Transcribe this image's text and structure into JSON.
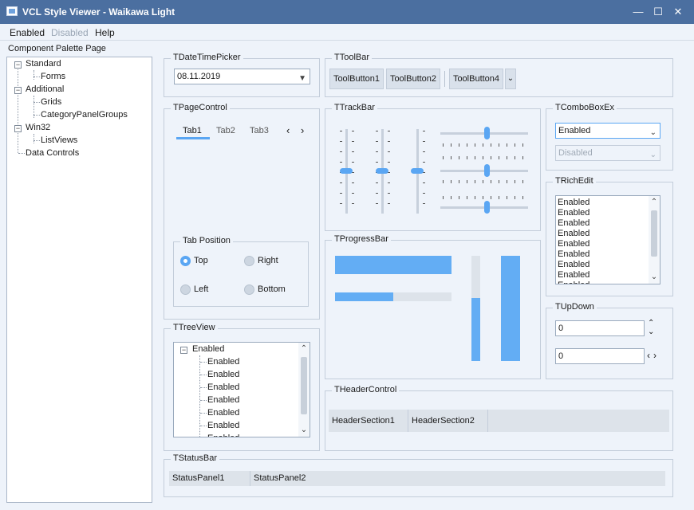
{
  "window": {
    "title": "VCL Style Viewer - Waikawa Light",
    "minimize_glyph": "—",
    "maximize_glyph": "☐",
    "close_glyph": "✕"
  },
  "menu": [
    "Enabled",
    "Disabled",
    "Help"
  ],
  "palette": {
    "label": "Component Palette Page",
    "tree": [
      "Standard",
      "Forms",
      "Additional",
      "Grids",
      "CategoryPanelGroups",
      "Win32",
      "ListViews",
      "Data Controls"
    ]
  },
  "datetimepicker": {
    "title": "TDateTimePicker",
    "value": "08.11.2019"
  },
  "toolbar": {
    "title": "TToolBar",
    "buttons": [
      "ToolButton1",
      "ToolButton2",
      "ToolButton4"
    ]
  },
  "pagecontrol": {
    "title": "TPageControl",
    "tabs": [
      "Tab1",
      "Tab2",
      "Tab3"
    ],
    "tab_position": {
      "title": "Tab Position",
      "options": [
        "Top",
        "Right",
        "Left",
        "Bottom"
      ],
      "selected": "Top"
    }
  },
  "trackbar": {
    "title": "TTrackBar"
  },
  "comboboxex": {
    "title": "TComboBoxEx",
    "enabled_value": "Enabled",
    "disabled_value": "Disabled"
  },
  "richedit": {
    "title": "TRichEdit",
    "lines": [
      "Enabled",
      "Enabled",
      "Enabled",
      "Enabled",
      "Enabled",
      "Enabled",
      "Enabled",
      "Enabled",
      "Enabled"
    ]
  },
  "progressbar": {
    "title": "TProgressBar",
    "values": [
      1.0,
      0.5,
      0.6,
      1.0
    ]
  },
  "updown": {
    "title": "TUpDown",
    "values": [
      "0",
      "0"
    ]
  },
  "treeview": {
    "title": "TTreeView",
    "root": "Enabled",
    "children": [
      "Enabled",
      "Enabled",
      "Enabled",
      "Enabled",
      "Enabled",
      "Enabled",
      "Enabled"
    ]
  },
  "headercontrol": {
    "title": "THeaderControl",
    "sections": [
      "HeaderSection1",
      "HeaderSection2"
    ]
  },
  "statusbar": {
    "title": "TStatusBar",
    "panels": [
      "StatusPanel1",
      "StatusPanel2"
    ]
  },
  "colors": {
    "accent": "#5aa6f3",
    "titlebar": "#4b6fa0",
    "background": "#eef3fa"
  }
}
